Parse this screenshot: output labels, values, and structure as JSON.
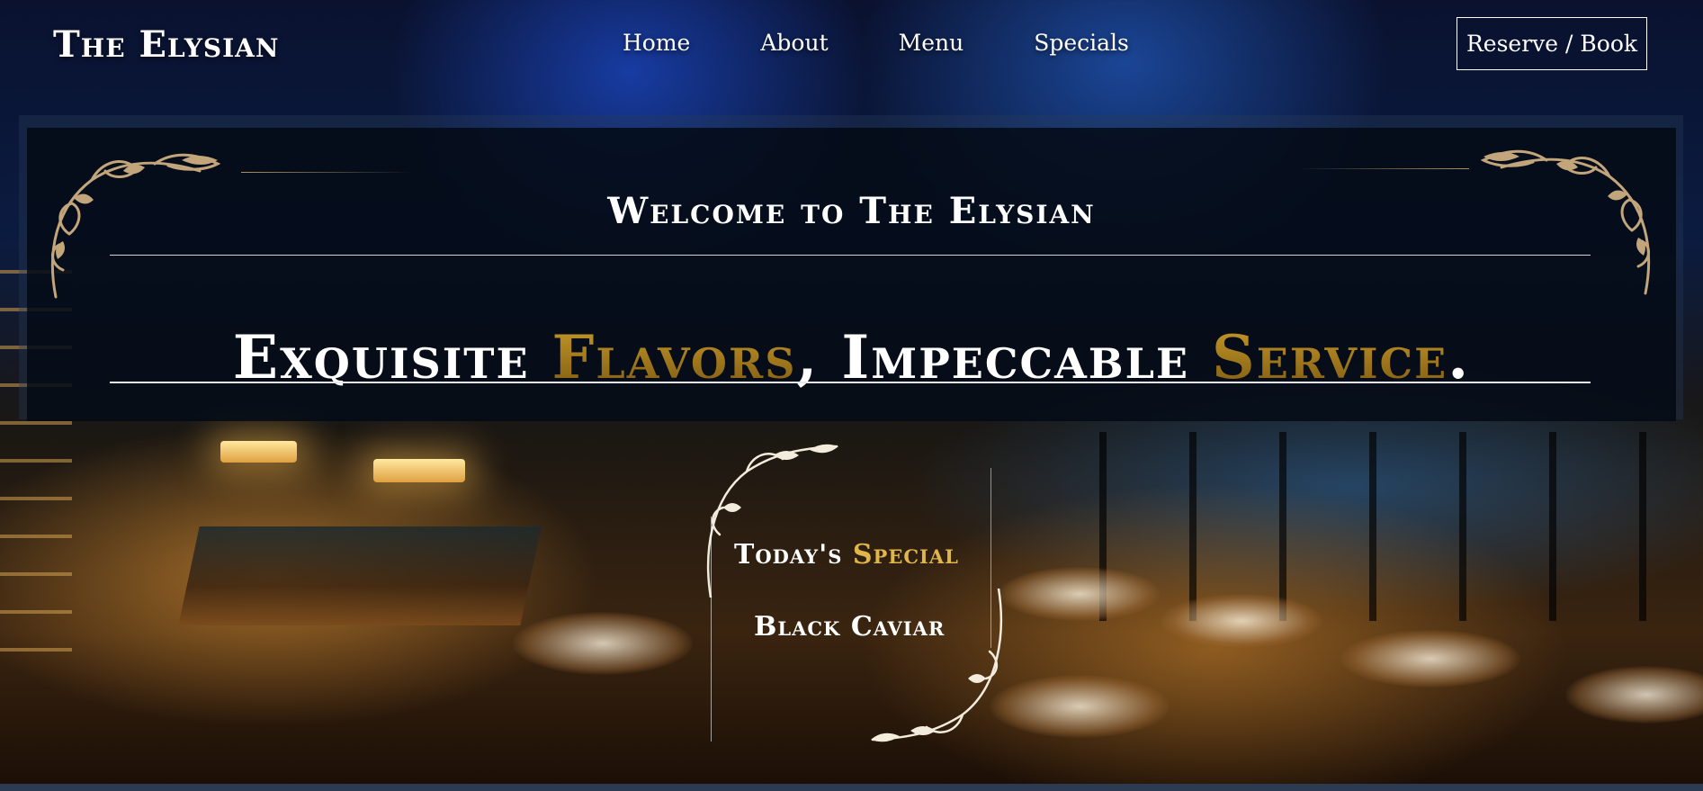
{
  "nav": {
    "brand": "The Elysian",
    "links": [
      "Home",
      "About",
      "Menu",
      "Specials"
    ],
    "reserve_label": "Reserve / Book"
  },
  "hero": {
    "welcome": "Welcome to The Elysian",
    "tagline": {
      "part1": "Exquisite ",
      "gold1": "Flavors",
      "part2": ", Impeccable ",
      "gold2": "Service",
      "part3": "."
    }
  },
  "special": {
    "title_prefix": "Today's ",
    "title_gold": "Special",
    "item": "Black Caviar"
  },
  "colors": {
    "accent_gold": "#b88a1c",
    "text": "#ffffff",
    "panel": "#030812"
  },
  "icons": {
    "flourish": "ornamental-flourish-icon"
  }
}
